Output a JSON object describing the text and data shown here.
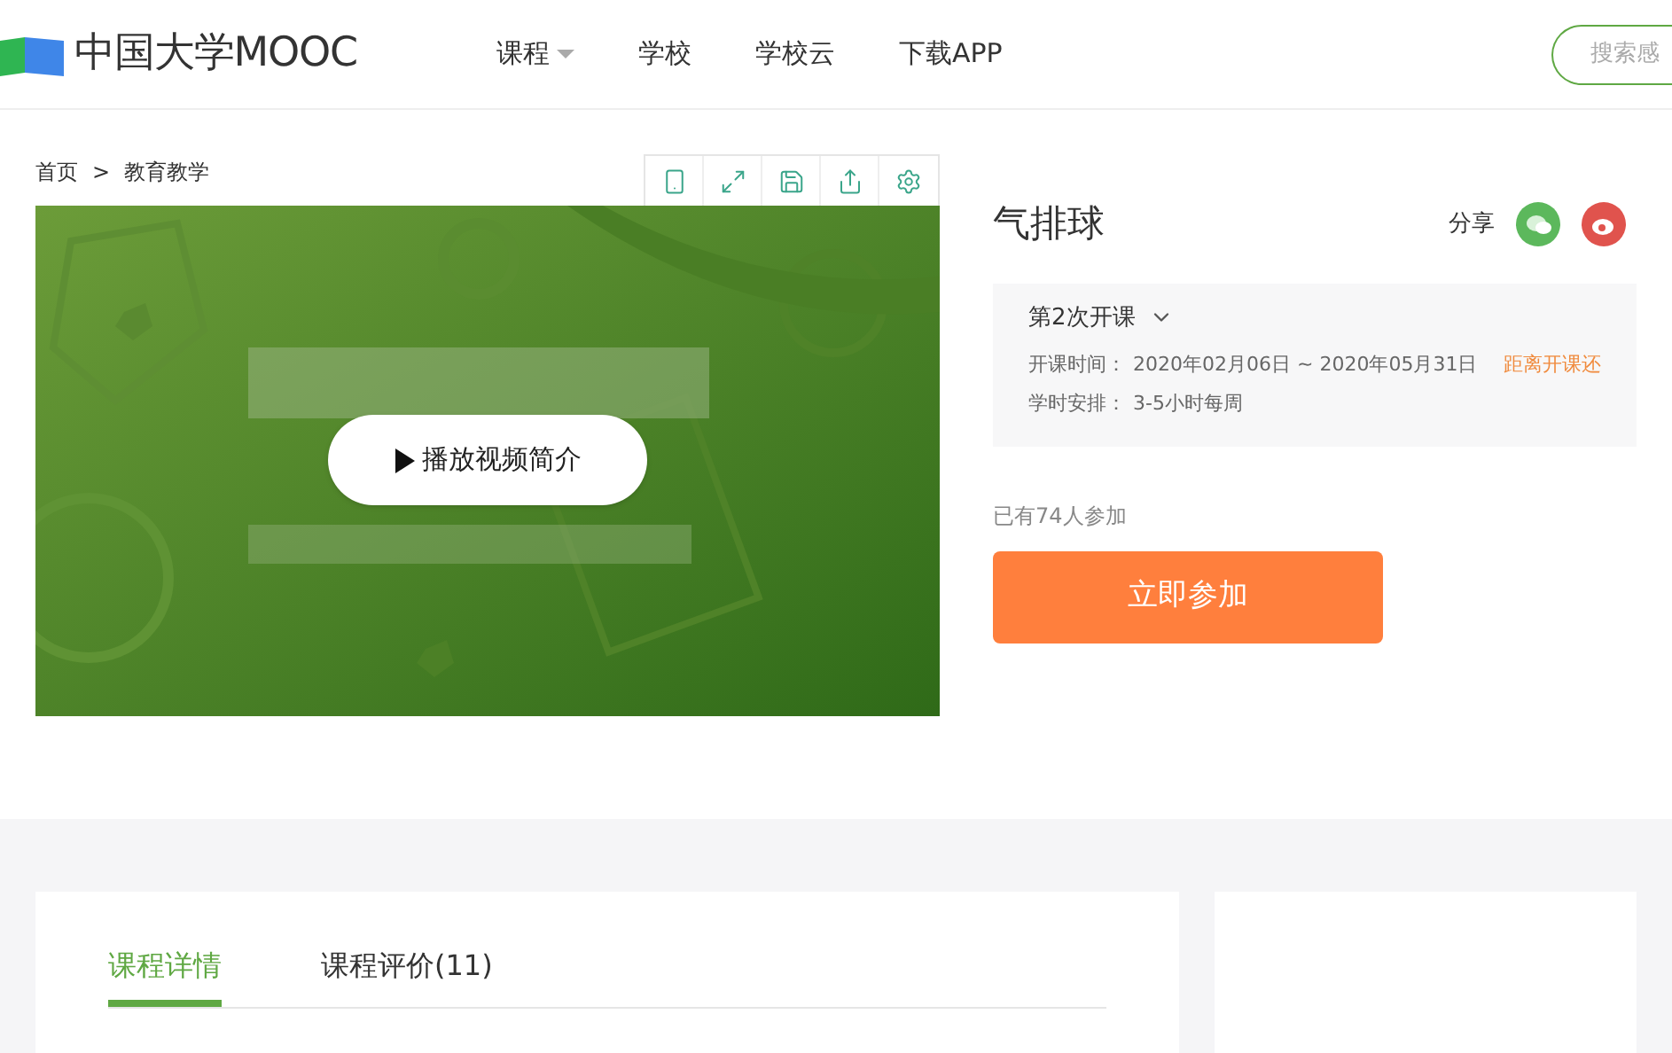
{
  "header": {
    "logo": "中国大学MOOC",
    "nav": [
      {
        "label": "课程",
        "dropdown": true
      },
      {
        "label": "学校",
        "dropdown": false
      },
      {
        "label": "学校云",
        "dropdown": false
      },
      {
        "label": "下载APP",
        "dropdown": false
      }
    ],
    "search": {
      "placeholder": "搜索感"
    }
  },
  "breadcrumb": [
    "首页",
    ">",
    "教育教学"
  ],
  "video": {
    "kind": "picture",
    "play_label": "播放视频简介"
  },
  "course": {
    "title": "气排球",
    "share_label": "分享",
    "term": "第2次开课",
    "details": [
      {
        "label": "开课时间：",
        "value": "2020年02月06日 ~ 2020年05月31日"
      },
      {
        "label": "学时安排：",
        "value": "3-5小时每周"
      }
    ],
    "countdown": "距离开课还",
    "participants": "已有74人参加",
    "join_button": "立即参加"
  },
  "tabs": [
    {
      "label": "课程详情",
      "selected": true
    },
    {
      "label": "课程评价(11)",
      "selected": false
    }
  ]
}
